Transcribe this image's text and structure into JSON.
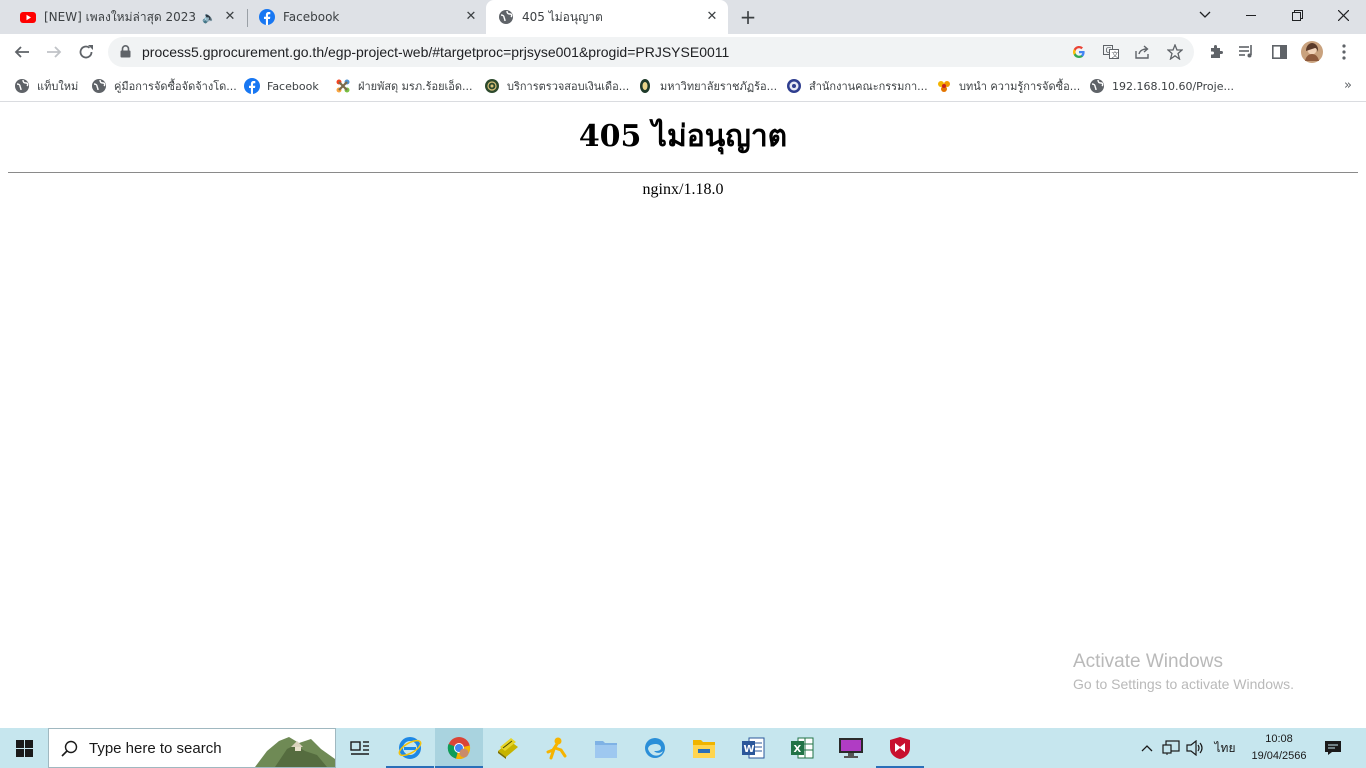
{
  "tabs": [
    {
      "title": "[NEW] เพลงใหม่ล่าสุด 2023 🎧 ,",
      "favicon": "youtube-icon",
      "active": false
    },
    {
      "title": "Facebook",
      "favicon": "facebook-icon",
      "active": false
    },
    {
      "title": "405 ไม่อนุญาต",
      "favicon": "globe-icon",
      "active": true
    }
  ],
  "toolbar": {
    "url": "process5.gprocurement.go.th/egp-project-web/#targetproc=prjsyse001&progid=PRJSYSE0011"
  },
  "bookmarks": [
    {
      "label": "แท็บใหม่",
      "icon": "globe-icon"
    },
    {
      "label": "คู่มือการจัดซื้อจัดจ้างโด...",
      "icon": "globe-icon"
    },
    {
      "label": "Facebook",
      "icon": "facebook-icon"
    },
    {
      "label": "ฝ่ายพัสดุ มรภ.ร้อยเอ็ด...",
      "icon": "joomla-icon"
    },
    {
      "label": "บริการตรวจสอบเงินเดือ...",
      "icon": "seal-icon"
    },
    {
      "label": "มหาวิทยาลัยราชภัฏร้อ...",
      "icon": "seal-icon"
    },
    {
      "label": "สำนักงานคณะกรรมกา...",
      "icon": "emblem-icon"
    },
    {
      "label": "บทนำ ความรู้การจัดซื้อ...",
      "icon": "flower-icon"
    },
    {
      "label": "192.168.10.60/Proje...",
      "icon": "globe-icon"
    }
  ],
  "page": {
    "heading": "405 ไม่อนุญาต",
    "server": "nginx/1.18.0"
  },
  "watermark": {
    "line1": "Activate Windows",
    "line2": "Go to Settings to activate Windows."
  },
  "taskbar": {
    "search_placeholder": "Type here to search",
    "language": "ไทย",
    "time": "10:08",
    "date": "19/04/2566",
    "apps": [
      "task-view-icon",
      "internet-explorer-icon",
      "chrome-icon",
      "books-app-icon",
      "messenger-app-icon",
      "file-folder-icon",
      "edge-icon",
      "file-explorer-icon",
      "word-icon",
      "excel-icon",
      "monitor-app-icon",
      "mcafee-icon"
    ]
  },
  "colors": {
    "tabstrip": "#dee1e6",
    "taskbar": "#c6e6ee",
    "accent": "#2a6fb8"
  }
}
